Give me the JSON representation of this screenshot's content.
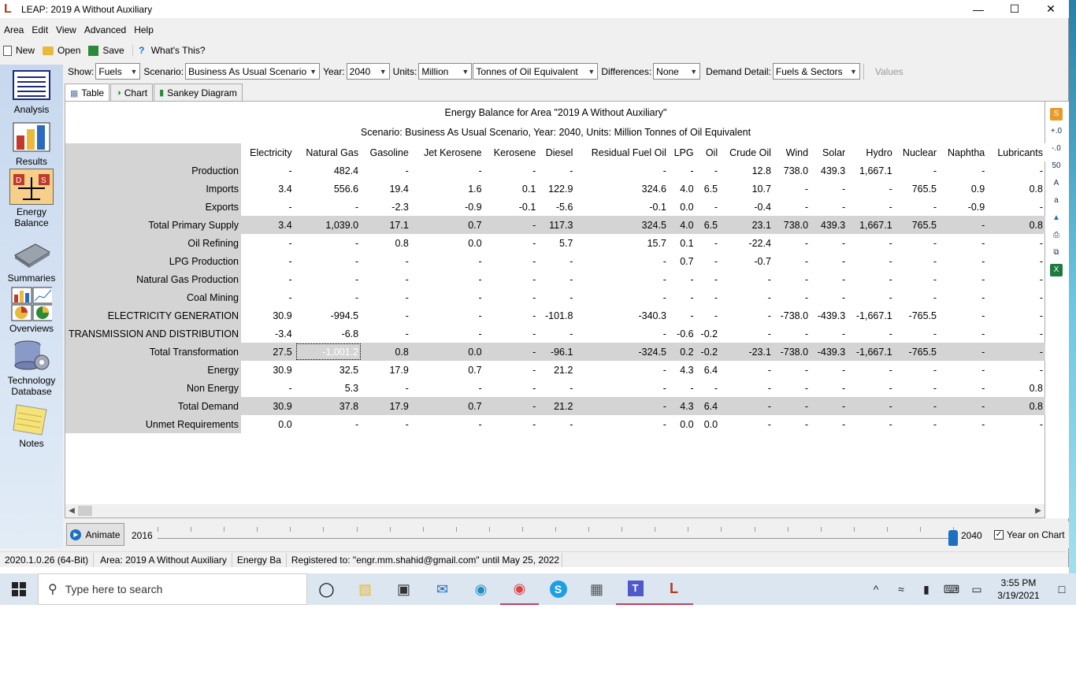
{
  "window": {
    "title": "LEAP: 2019 A Without Auxiliary",
    "logo": "L",
    "minimize": "—",
    "maximize": "☐",
    "close": "✕"
  },
  "menu": [
    "Area",
    "Edit",
    "View",
    "Advanced",
    "Help"
  ],
  "toolbar": {
    "new": "New",
    "open": "Open",
    "save": "Save",
    "whats_this": "What's This?"
  },
  "sidebar": [
    "Analysis",
    "Results",
    "Energy Balance",
    "Summaries",
    "Overviews",
    "Technology Database",
    "Notes"
  ],
  "filters": {
    "show_label": "Show:",
    "show": "Fuels",
    "scenario_label": "Scenario:",
    "scenario": "Business As Usual Scenario",
    "year_label": "Year:",
    "year": "2040",
    "units_label": "Units:",
    "units": "Million",
    "unit_type": "Tonnes of Oil Equivalent",
    "diff_label": "Differences:",
    "diff": "None",
    "detail_label": "Demand Detail:",
    "detail": "Fuels & Sectors",
    "values": "Values"
  },
  "tabs": [
    "Table",
    "Chart",
    "Sankey Diagram"
  ],
  "report": {
    "title": "Energy Balance for Area \"2019 A Without Auxiliary\"",
    "subtitle": "Scenario: Business As Usual Scenario, Year: 2040, Units: Million Tonnes of Oil Equivalent",
    "columns": [
      "Electricity",
      "Natural Gas",
      "Gasoline",
      "Jet Kerosene",
      "Kerosene",
      "Diesel",
      "Residual Fuel Oil",
      "LPG",
      "Oil",
      "Crude Oil",
      "Wind",
      "Solar",
      "Hydro",
      "Nuclear",
      "Naphtha",
      "Lubricants"
    ],
    "rows": [
      {
        "label": "Production",
        "total": false,
        "cells": [
          "-",
          "482.4",
          "-",
          "-",
          "-",
          "-",
          "-",
          "-",
          "-",
          "12.8",
          "738.0",
          "439.3",
          "1,667.1",
          "-",
          "-",
          "-"
        ]
      },
      {
        "label": "Imports",
        "total": false,
        "cells": [
          "3.4",
          "556.6",
          "19.4",
          "1.6",
          "0.1",
          "122.9",
          "324.6",
          "4.0",
          "6.5",
          "10.7",
          "-",
          "-",
          "-",
          "765.5",
          "0.9",
          "0.8"
        ]
      },
      {
        "label": "Exports",
        "total": false,
        "cells": [
          "-",
          "-",
          "-2.3",
          "-0.9",
          "-0.1",
          "-5.6",
          "-0.1",
          "0.0",
          "-",
          "-0.4",
          "-",
          "-",
          "-",
          "-",
          "-0.9",
          "-"
        ]
      },
      {
        "label": "Total Primary Supply",
        "total": true,
        "cells": [
          "3.4",
          "1,039.0",
          "17.1",
          "0.7",
          "-",
          "117.3",
          "324.5",
          "4.0",
          "6.5",
          "23.1",
          "738.0",
          "439.3",
          "1,667.1",
          "765.5",
          "-",
          "0.8"
        ]
      },
      {
        "label": "Oil Refining",
        "total": false,
        "cells": [
          "-",
          "-",
          "0.8",
          "0.0",
          "-",
          "5.7",
          "15.7",
          "0.1",
          "-",
          "-22.4",
          "-",
          "-",
          "-",
          "-",
          "-",
          "-"
        ]
      },
      {
        "label": "LPG Production",
        "total": false,
        "cells": [
          "-",
          "-",
          "-",
          "-",
          "-",
          "-",
          "-",
          "0.7",
          "-",
          "-0.7",
          "-",
          "-",
          "-",
          "-",
          "-",
          "-"
        ]
      },
      {
        "label": "Natural Gas Production",
        "total": false,
        "cells": [
          "-",
          "-",
          "-",
          "-",
          "-",
          "-",
          "-",
          "-",
          "-",
          "-",
          "-",
          "-",
          "-",
          "-",
          "-",
          "-"
        ]
      },
      {
        "label": "Coal Mining",
        "total": false,
        "cells": [
          "-",
          "-",
          "-",
          "-",
          "-",
          "-",
          "-",
          "-",
          "-",
          "-",
          "-",
          "-",
          "-",
          "-",
          "-",
          "-"
        ]
      },
      {
        "label": "ELECTRICITY GENERATION",
        "total": false,
        "cells": [
          "30.9",
          "-994.5",
          "-",
          "-",
          "-",
          "-101.8",
          "-340.3",
          "-",
          "-",
          "-",
          "-738.0",
          "-439.3",
          "-1,667.1",
          "-765.5",
          "-",
          "-"
        ]
      },
      {
        "label": "TRANSMISSION AND DISTRIBUTION",
        "total": false,
        "cells": [
          "-3.4",
          "-6.8",
          "-",
          "-",
          "-",
          "-",
          "-",
          "-0.6",
          "-0.2",
          "-",
          "-",
          "-",
          "-",
          "-",
          "-",
          "-"
        ]
      },
      {
        "label": "Total Transformation",
        "total": true,
        "cells": [
          "27.5",
          "-1,001.2",
          "0.8",
          "0.0",
          "-",
          "-96.1",
          "-324.5",
          "0.2",
          "-0.2",
          "-23.1",
          "-738.0",
          "-439.3",
          "-1,667.1",
          "-765.5",
          "-",
          "-"
        ]
      },
      {
        "label": "Energy",
        "total": false,
        "cells": [
          "30.9",
          "32.5",
          "17.9",
          "0.7",
          "-",
          "21.2",
          "-",
          "4.3",
          "6.4",
          "-",
          "-",
          "-",
          "-",
          "-",
          "-",
          "-"
        ]
      },
      {
        "label": "Non Energy",
        "total": false,
        "cells": [
          "-",
          "5.3",
          "-",
          "-",
          "-",
          "-",
          "-",
          "-",
          "-",
          "-",
          "-",
          "-",
          "-",
          "-",
          "-",
          "0.8"
        ]
      },
      {
        "label": "Total Demand",
        "total": true,
        "cells": [
          "30.9",
          "37.8",
          "17.9",
          "0.7",
          "-",
          "21.2",
          "-",
          "4.3",
          "6.4",
          "-",
          "-",
          "-",
          "-",
          "-",
          "-",
          "0.8"
        ]
      },
      {
        "label": "Unmet Requirements",
        "total": false,
        "cells": [
          "0.0",
          "-",
          "-",
          "-",
          "-",
          "-",
          "-",
          "0.0",
          "0.0",
          "-",
          "-",
          "-",
          "-",
          "-",
          "-",
          "-"
        ]
      }
    ]
  },
  "animation": {
    "button": "Animate",
    "start_year": "2016",
    "end_year": "2040",
    "year_on_chart": "Year on Chart",
    "year_on_chart_checked": true
  },
  "status": [
    "2020.1.0.26 (64-Bit)",
    "Area: 2019 A Without Auxiliary",
    "Energy Ba",
    "Registered to: \"engr.mm.shahid@gmail.com\" until May 25, 2022"
  ],
  "taskbar": {
    "search_placeholder": "Type here to search",
    "time": "3:55 PM",
    "date": "3/19/2021"
  }
}
